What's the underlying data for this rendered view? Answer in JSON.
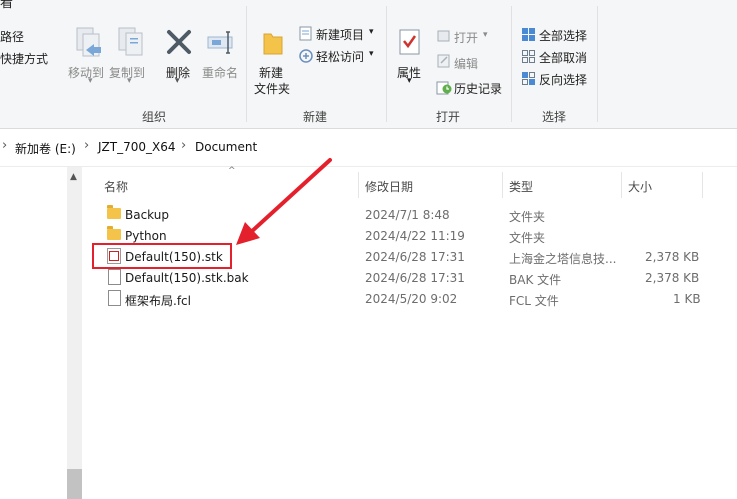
{
  "ribbon": {
    "organize": {
      "cut_path_partial": "路径",
      "paste_shortcut_partial": "快捷方式",
      "move_to": "移动到",
      "copy_to": "复制到",
      "delete": "删除",
      "rename": "重命名",
      "group_label": "组织"
    },
    "new": {
      "new_folder_line1": "新建",
      "new_folder_line2": "文件夹",
      "new_item": "新建项目",
      "easy_access": "轻松访问",
      "group_label": "新建"
    },
    "open": {
      "properties": "属性",
      "open": "打开",
      "edit": "编辑",
      "history": "历史记录",
      "group_label": "打开"
    },
    "select": {
      "select_all": "全部选择",
      "select_none": "全部取消",
      "invert": "反向选择",
      "group_label": "选择"
    }
  },
  "address": {
    "crumbs": [
      "新加卷 (E:)",
      "JZT_700_X64",
      "Document"
    ]
  },
  "columns": {
    "name": "名称",
    "modified": "修改日期",
    "type": "类型",
    "size": "大小"
  },
  "files": [
    {
      "name": "Backup",
      "modified": "2024/7/1 8:48",
      "type": "文件夹",
      "size": "",
      "icon": "folder-icon"
    },
    {
      "name": "Python",
      "modified": "2024/4/22 11:19",
      "type": "文件夹",
      "size": "",
      "icon": "folder-icon"
    },
    {
      "name": "Default(150).stk",
      "modified": "2024/6/28 17:31",
      "type": "上海金之塔信息技...",
      "size": "2,378 KB",
      "icon": "stk-file-icon"
    },
    {
      "name": "Default(150).stk.bak",
      "modified": "2024/6/28 17:31",
      "type": "BAK 文件",
      "size": "2,378 KB",
      "icon": "file-icon"
    },
    {
      "name": "框架布局.fcl",
      "modified": "2024/5/20 9:02",
      "type": "FCL 文件",
      "size": "1 KB",
      "icon": "file-icon"
    }
  ],
  "colors": {
    "annotation": "#e4202c",
    "folder": "#f4c34a"
  }
}
